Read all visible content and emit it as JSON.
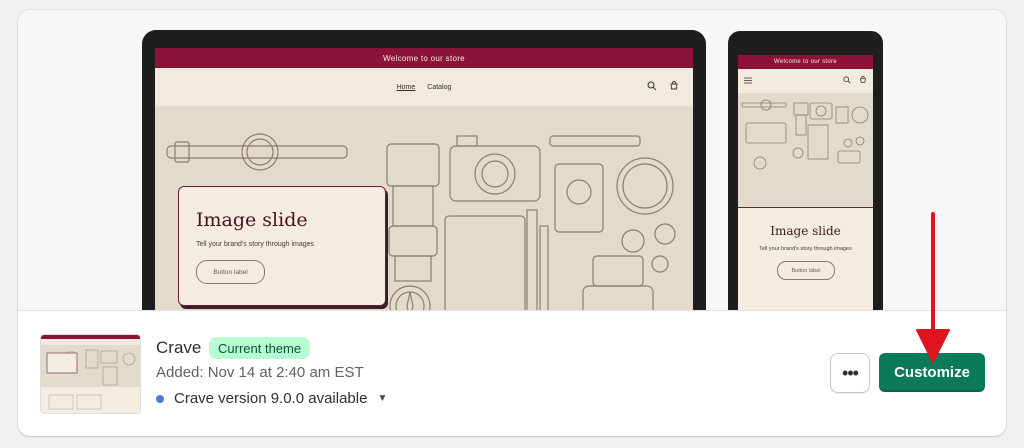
{
  "preview": {
    "desktop": {
      "announcement": "Welcome to our store",
      "nav": [
        "Home",
        "Catalog"
      ],
      "slide": {
        "title": "Image slide",
        "subtitle": "Tell your brand's story through images",
        "button": "Button label"
      }
    },
    "mobile": {
      "announcement": "Welcome to our store",
      "slide": {
        "title": "Image slide",
        "subtitle": "Tell your brand's story through images",
        "button": "Button label"
      }
    }
  },
  "theme": {
    "name": "Crave",
    "badge": "Current theme",
    "added": "Added: Nov 14 at 2:40 am EST",
    "version": "Crave version 9.0.0 available"
  },
  "actions": {
    "more_label": "•••",
    "customize_label": "Customize"
  },
  "colors": {
    "announcement_bar": "#8c1239",
    "primary_button": "#0b7a5a",
    "badge_bg": "#b4fed2",
    "annotation_arrow": "#e0141e"
  },
  "icons": [
    "search-icon",
    "cart-icon",
    "menu-icon",
    "chevron-down-icon",
    "more-horizontal-icon"
  ]
}
